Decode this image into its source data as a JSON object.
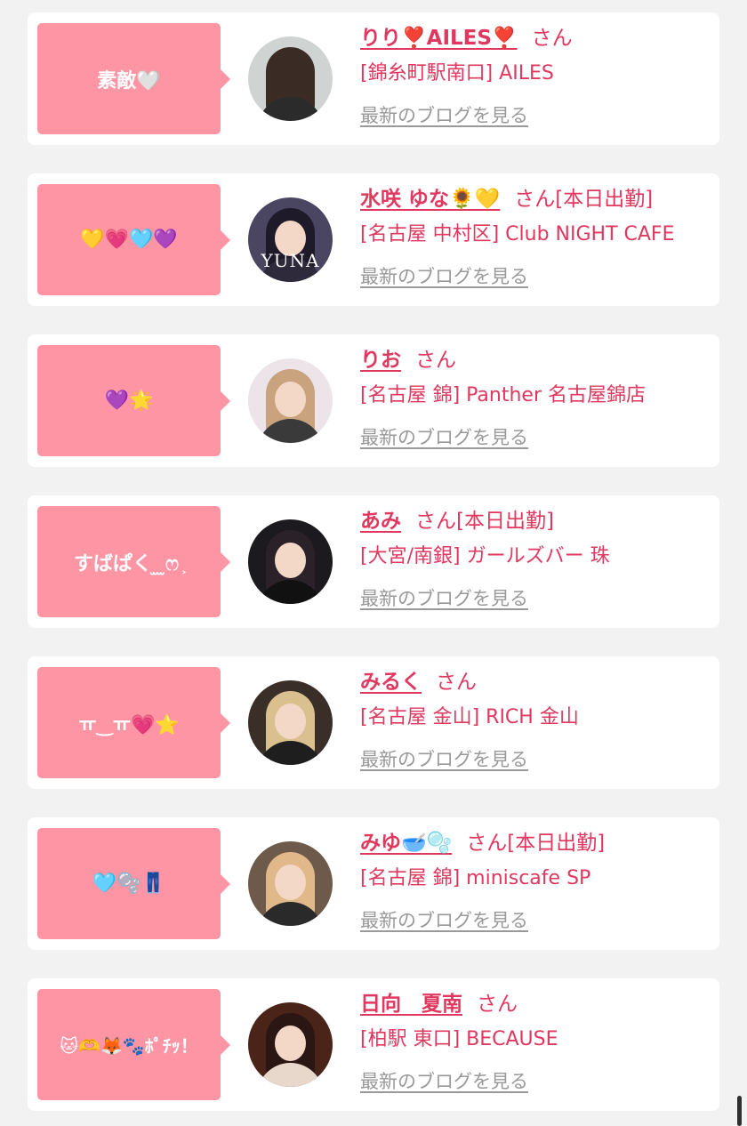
{
  "posts": [
    {
      "message": "素敵🤍",
      "name": "りり❣️AILES❣️",
      "suffix": "さん",
      "status": "",
      "shop": "[錦糸町駅南口] AILES",
      "blog_link": "最新のブログを見る",
      "avatar_text": ""
    },
    {
      "message": "💛💗🩵💜",
      "name": "水咲 ゆな🌻💛",
      "suffix": "さん",
      "status": "[本日出勤]",
      "shop": "[名古屋 中村区] Club NIGHT CAFE",
      "blog_link": "最新のブログを見る",
      "avatar_text": "YUNA"
    },
    {
      "message": "💜🌟",
      "name": "りお",
      "suffix": "さん",
      "status": "",
      "shop": "[名古屋 錦] Panther 名古屋錦店",
      "blog_link": "最新のブログを見る",
      "avatar_text": ""
    },
    {
      "message": "すばぱく ̫ ̫ෆ ͕",
      "name": "あみ",
      "suffix": "さん",
      "status": "[本日出勤]",
      "shop": "[大宮/南銀] ガールズバー 珠",
      "blog_link": "最新のブログを見る",
      "avatar_text": ""
    },
    {
      "message": "ㅠ‿ㅠ💗⭐",
      "name": "みるく",
      "suffix": "さん",
      "status": "",
      "shop": "[名古屋 金山] RICH 金山",
      "blog_link": "最新のブログを見る",
      "avatar_text": ""
    },
    {
      "message": "🩵🫧👖",
      "name": "みゆ🥣🫧",
      "suffix": "さん",
      "status": "[本日出勤]",
      "shop": "[名古屋 錦] miniscafe SP",
      "blog_link": "最新のブログを見る",
      "avatar_text": ""
    },
    {
      "message": "🐱🫶🦊🐾ﾎﾟﾁｯ！",
      "name": "日向　夏南",
      "suffix": "さん",
      "status": "",
      "shop": "[柏駅 東口] BECAUSE",
      "blog_link": "最新のブログを見る",
      "avatar_text": ""
    }
  ],
  "colors": {
    "accent": "#e0385f",
    "bubble": "#fe95a5",
    "link_gray": "#999999",
    "card_bg": "#ffffff",
    "page_bg": "#f2f2f2"
  }
}
